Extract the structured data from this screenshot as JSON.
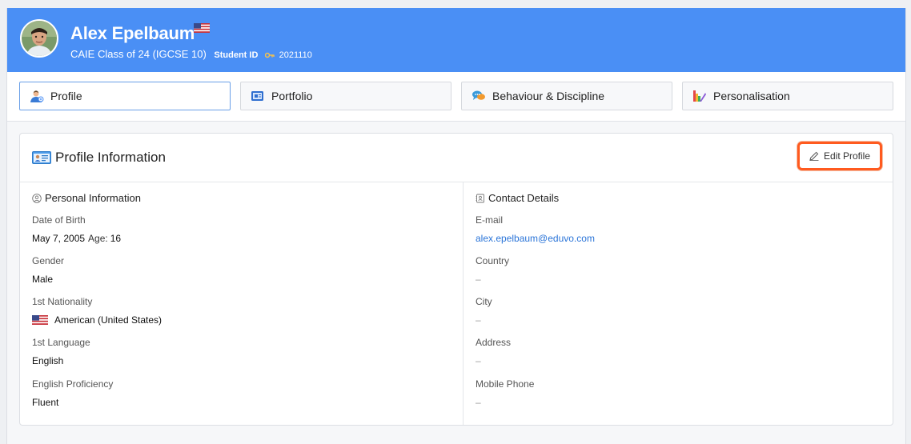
{
  "student": {
    "name": "Alex Epelbaum",
    "class_line": "CAIE Class of 24 (IGCSE 10)",
    "student_id_label": "Student ID",
    "student_id": "2021110"
  },
  "tabs": [
    {
      "label": "Profile",
      "icon": "profile-icon",
      "active": true
    },
    {
      "label": "Portfolio",
      "icon": "portfolio-icon",
      "active": false
    },
    {
      "label": "Behaviour & Discipline",
      "icon": "behaviour-icon",
      "active": false
    },
    {
      "label": "Personalisation",
      "icon": "personalisation-icon",
      "active": false
    }
  ],
  "card": {
    "title": "Profile Information",
    "edit_label": "Edit Profile"
  },
  "personal": {
    "title": "Personal Information",
    "dob_label": "Date of Birth",
    "dob_value": "May 7, 2005",
    "age_label": "Age:",
    "age_value": "16",
    "gender_label": "Gender",
    "gender_value": "Male",
    "nationality_label": "1st Nationality",
    "nationality_value": "American (United States)",
    "language_label": "1st Language",
    "language_value": "English",
    "proficiency_label": "English Proficiency",
    "proficiency_value": "Fluent"
  },
  "contact": {
    "title": "Contact Details",
    "email_label": "E-mail",
    "email_value": "alex.epelbaum@eduvo.com",
    "country_label": "Country",
    "country_value": "–",
    "city_label": "City",
    "city_value": "–",
    "address_label": "Address",
    "address_value": "–",
    "mobile_label": "Mobile Phone",
    "mobile_value": "–"
  },
  "colors": {
    "header": "#4a8ff5",
    "highlight": "#ff5a1f",
    "link": "#2a74d8"
  }
}
